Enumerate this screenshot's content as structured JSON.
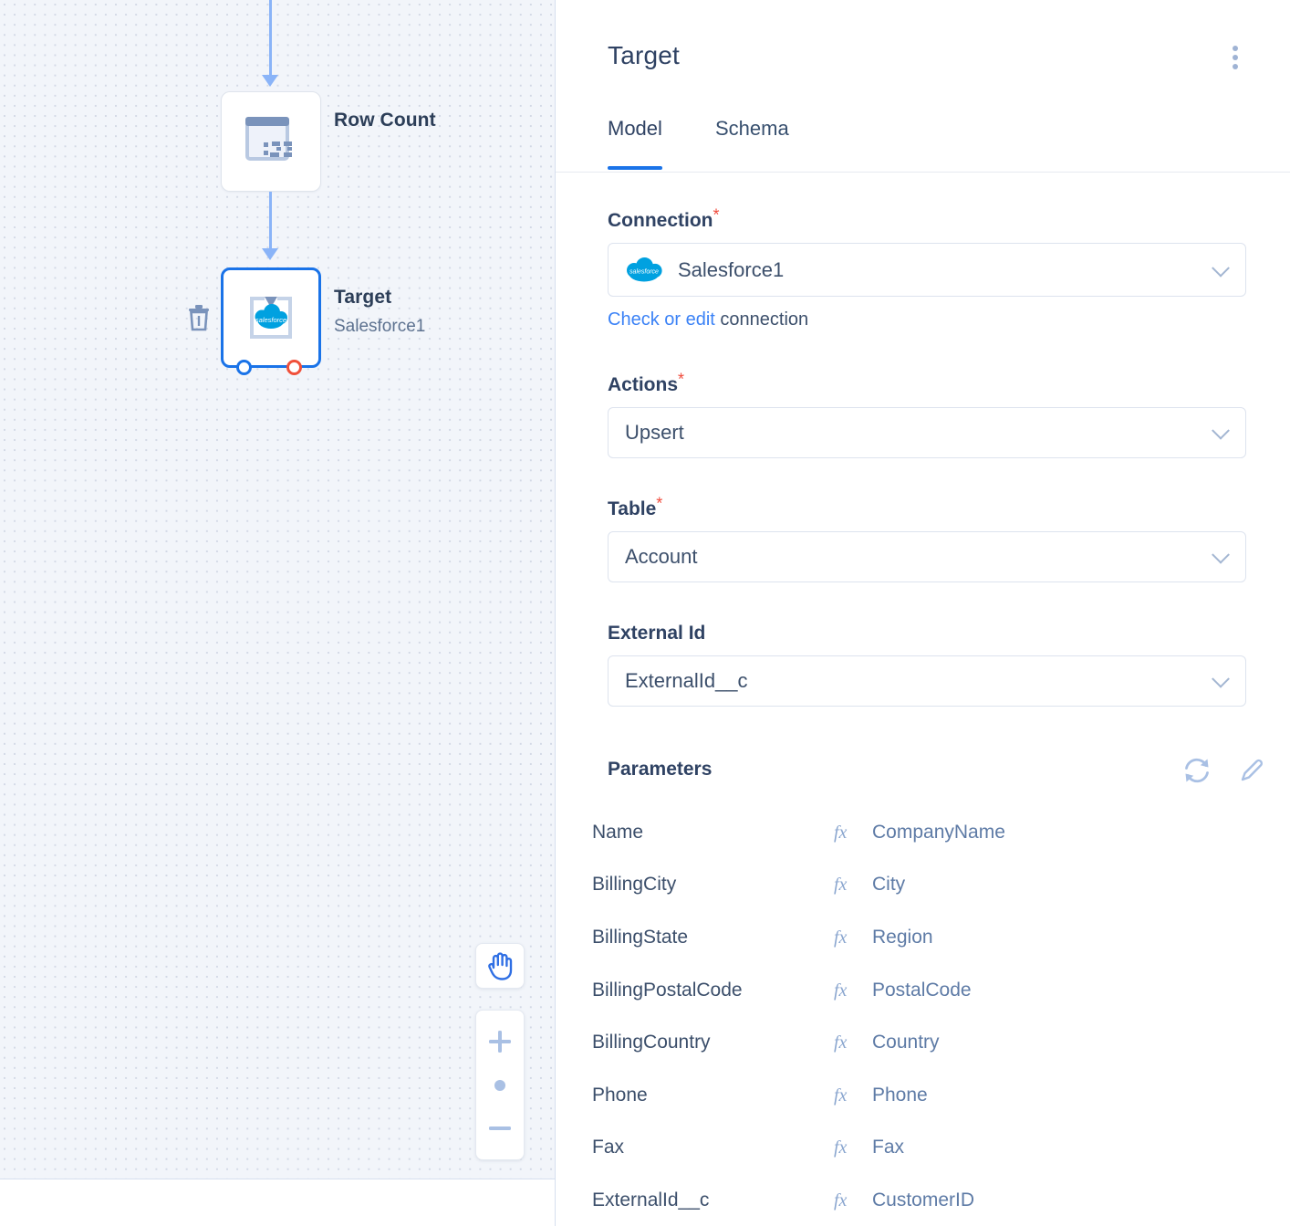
{
  "canvas": {
    "nodes": [
      {
        "id": "row-count",
        "label": "Row Count",
        "sub": "",
        "icon": "table-numbers-icon",
        "selected": false
      },
      {
        "id": "target",
        "label": "Target",
        "sub": "Salesforce1",
        "icon": "salesforce-import-icon",
        "selected": true
      }
    ],
    "controls": {
      "hand": "hand-pan-icon",
      "zoom_in": "plus-icon",
      "zoom_reset": "dot-icon",
      "zoom_out": "minus-icon"
    },
    "delete_tooltip": "trash-icon"
  },
  "panel": {
    "title": "Target",
    "menu_icon": "kebab-menu-icon",
    "tabs": [
      {
        "label": "Model",
        "active": true
      },
      {
        "label": "Schema",
        "active": false
      }
    ],
    "fields": {
      "connection": {
        "label": "Connection",
        "required": "*",
        "value": "Salesforce1",
        "icon": "salesforce-logo-icon",
        "help_link_text": "Check or edit",
        "help_rest_text": " connection"
      },
      "actions": {
        "label": "Actions",
        "required": "*",
        "value": "Upsert"
      },
      "table": {
        "label": "Table",
        "required": "*",
        "value": "Account"
      },
      "external_id": {
        "label": "External Id",
        "required": "",
        "value": "ExternalId__c"
      }
    },
    "parameters": {
      "title": "Parameters",
      "refresh_icon": "refresh-icon",
      "edit_icon": "pencil-edit-icon",
      "fx_icon": "fx-function-icon",
      "rows": [
        {
          "key": "Name",
          "value": "CompanyName"
        },
        {
          "key": "BillingCity",
          "value": "City"
        },
        {
          "key": "BillingState",
          "value": "Region"
        },
        {
          "key": "BillingPostalCode",
          "value": "PostalCode"
        },
        {
          "key": "BillingCountry",
          "value": "Country"
        },
        {
          "key": "Phone",
          "value": "Phone"
        },
        {
          "key": "Fax",
          "value": "Fax"
        },
        {
          "key": "ExternalId__c",
          "value": "CustomerID"
        }
      ]
    }
  },
  "colors": {
    "accent": "#1a73e8",
    "edge": "#8ab4f8",
    "required": "#f04b3c",
    "salesforce": "#00a1e0",
    "canvas_bg": "#f2f5fa",
    "port_out": "#f0503a"
  }
}
